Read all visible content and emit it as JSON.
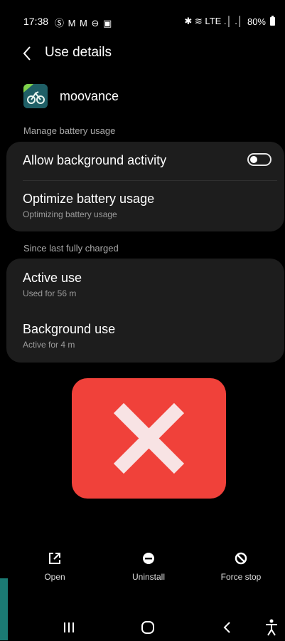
{
  "status_bar": {
    "time": "17:38",
    "left_icons": "Ⓢ M M ⊖ ▣",
    "right_icons": "✱ ≋ LTE .│ .│",
    "battery": "80%"
  },
  "header": {
    "title": "Use details"
  },
  "app": {
    "name": "moovance",
    "icon_color": "#1f5f66"
  },
  "sections": {
    "manage_label": "Manage battery usage",
    "since_label": "Since last fully charged"
  },
  "battery_card": {
    "background_title": "Allow background activity",
    "background_enabled": false,
    "optimize_title": "Optimize battery usage",
    "optimize_sub": "Optimizing battery usage"
  },
  "usage_card": {
    "active_title": "Active use",
    "active_sub": "Used for 56 m",
    "background_title": "Background use",
    "background_sub": "Active for 4 m"
  },
  "overlay": {
    "color": "#f0413a",
    "icon": "close-icon"
  },
  "actions": {
    "open": "Open",
    "uninstall": "Uninstall",
    "force_stop": "Force stop"
  }
}
